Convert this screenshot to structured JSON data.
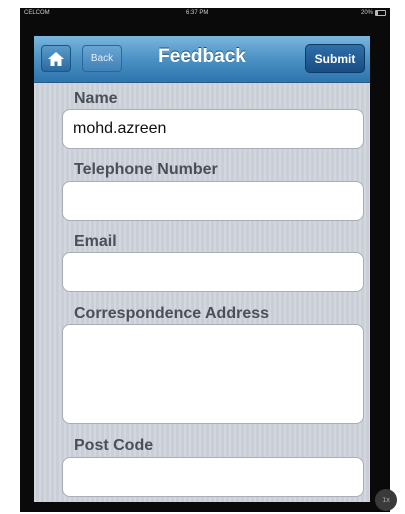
{
  "status_bar": {
    "carrier": "CELCOM",
    "time": "6:37 PM",
    "battery": "20%"
  },
  "navbar": {
    "home_icon": "home-icon",
    "back_label": "Back",
    "title": "Feedback",
    "submit_label": "Submit"
  },
  "form": {
    "name_label": "Name",
    "name_value": "mohd.azreen",
    "telephone_label": "Telephone Number",
    "telephone_value": "",
    "email_label": "Email",
    "email_value": "",
    "address_label": "Correspondence Address",
    "address_value": "",
    "postcode_label": "Post Code",
    "postcode_value": ""
  },
  "zoom_badge": "1x",
  "colors": {
    "navbar_top": "#7ab7dd",
    "navbar_bottom": "#2d74ad",
    "submit_button": "#174d83",
    "panel_background": "#c9ced7"
  }
}
